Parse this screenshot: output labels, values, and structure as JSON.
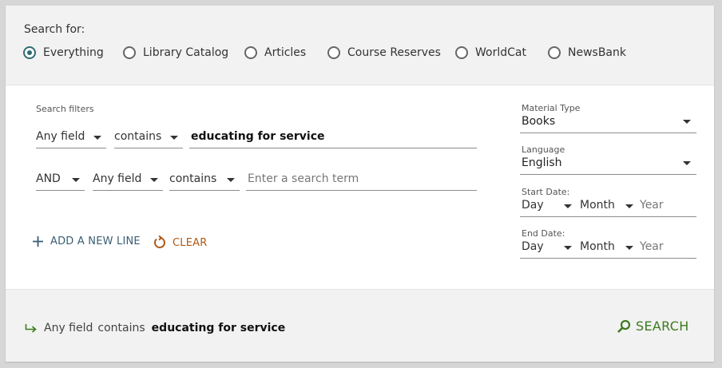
{
  "search_for": {
    "label": "Search for:",
    "options": [
      "Everything",
      "Library Catalog",
      "Articles",
      "Course Reserves",
      "WorldCat",
      "NewsBank"
    ],
    "selected": "Everything"
  },
  "filters": {
    "label": "Search filters",
    "line1": {
      "field": "Any field",
      "operator": "contains",
      "term": "educating for service"
    },
    "line2": {
      "boolean": "AND",
      "field": "Any field",
      "operator": "contains",
      "term": "",
      "placeholder": "Enter a search term"
    },
    "add_line_label": "ADD A NEW LINE",
    "clear_label": "CLEAR"
  },
  "side": {
    "material_type": {
      "label": "Material Type",
      "value": "Books"
    },
    "language": {
      "label": "Language",
      "value": "English"
    },
    "start_date": {
      "label": "Start Date:",
      "day": "Day",
      "month": "Month",
      "year_placeholder": "Year"
    },
    "end_date": {
      "label": "End Date:",
      "day": "Day",
      "month": "Month",
      "year_placeholder": "Year"
    }
  },
  "summary": {
    "field": "Any field",
    "operator": "contains",
    "term": "educating for service",
    "search_label": "SEARCH"
  },
  "colors": {
    "accent_teal": "#2f6b73",
    "search_green": "#3d7a1e",
    "clear_orange": "#b05a18",
    "add_blue": "#3a5e74"
  }
}
